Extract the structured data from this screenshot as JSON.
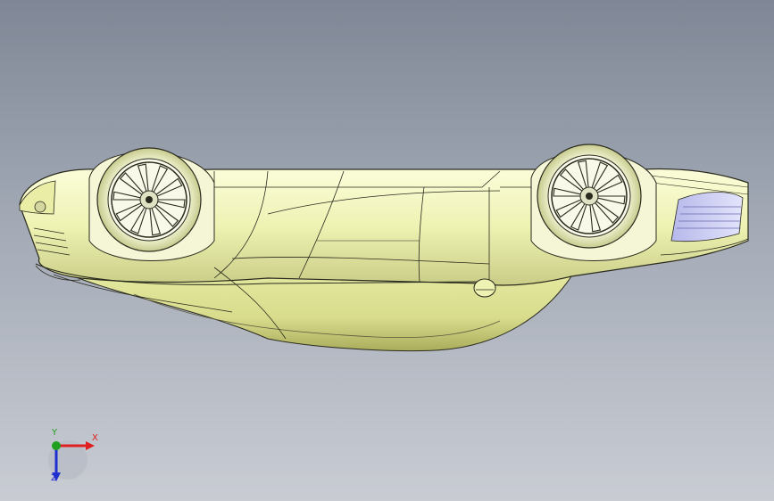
{
  "viewport": {
    "background_top": "#7f8796",
    "background_bottom": "#c9ccd3"
  },
  "model": {
    "name_icon": "car-body-model-upside-down",
    "body_color": "#eef2b2",
    "edge_color": "#2a2a1e",
    "glass_color": "#c8c9ef"
  },
  "triad": {
    "x_label": "X",
    "y_label": "Y",
    "z_label": "Z",
    "x_color": "#e02020",
    "y_color": "#1fa01f",
    "z_color": "#2030d0"
  }
}
